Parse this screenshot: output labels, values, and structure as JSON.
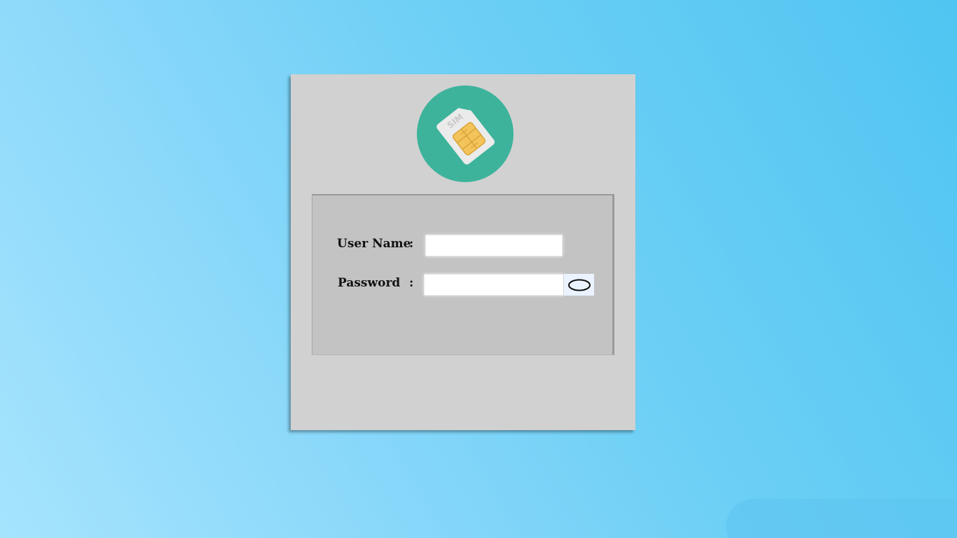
{
  "app": {
    "logo_icon": "sim-card-icon",
    "logo_text": "SIM",
    "colors": {
      "logo_circle": "#3db39c",
      "card_bg": "#d1d1d1",
      "panel_bg": "#c3c3c3",
      "chip": "#f2c45a"
    }
  },
  "form": {
    "username": {
      "label": "User Name",
      "separator": ":",
      "value": "",
      "placeholder": ""
    },
    "password": {
      "label": "Password",
      "separator": ":",
      "value": "",
      "placeholder": "",
      "toggle_icon": "eye-icon"
    }
  }
}
